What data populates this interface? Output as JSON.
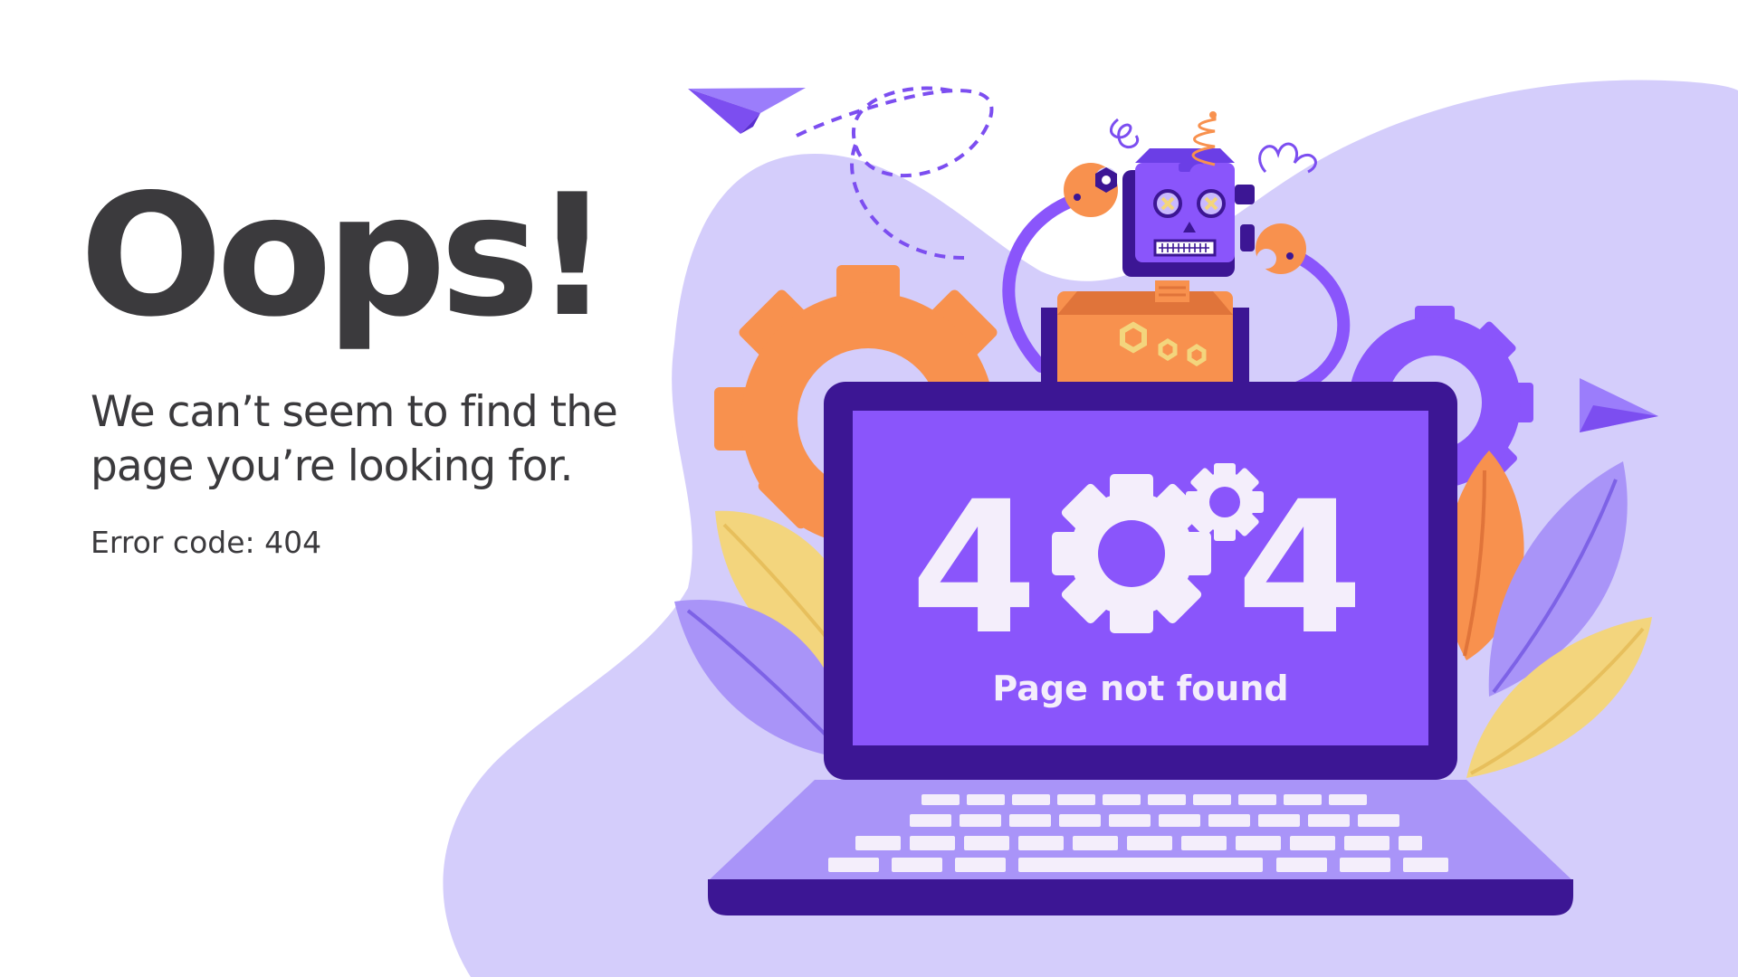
{
  "headline": "Oops!",
  "message": "We can’t seem to find the page you’re looking for.",
  "error_code_line": "Error code: 404",
  "screen": {
    "digit_left": "4",
    "digit_right": "4",
    "caption": "Page not found"
  },
  "illustration": {
    "icons": [
      "paper-plane-icon",
      "robot-icon",
      "gear-icon",
      "laptop-icon",
      "keyboard-icon",
      "leaf-icon"
    ],
    "colors": {
      "purple": "#8a55fb",
      "dark_purple": "#3c1694",
      "lavender": "#d4cdfb",
      "orange": "#f8914e",
      "yellow": "#f3d57d",
      "text_dark": "#3b3a3d"
    }
  }
}
